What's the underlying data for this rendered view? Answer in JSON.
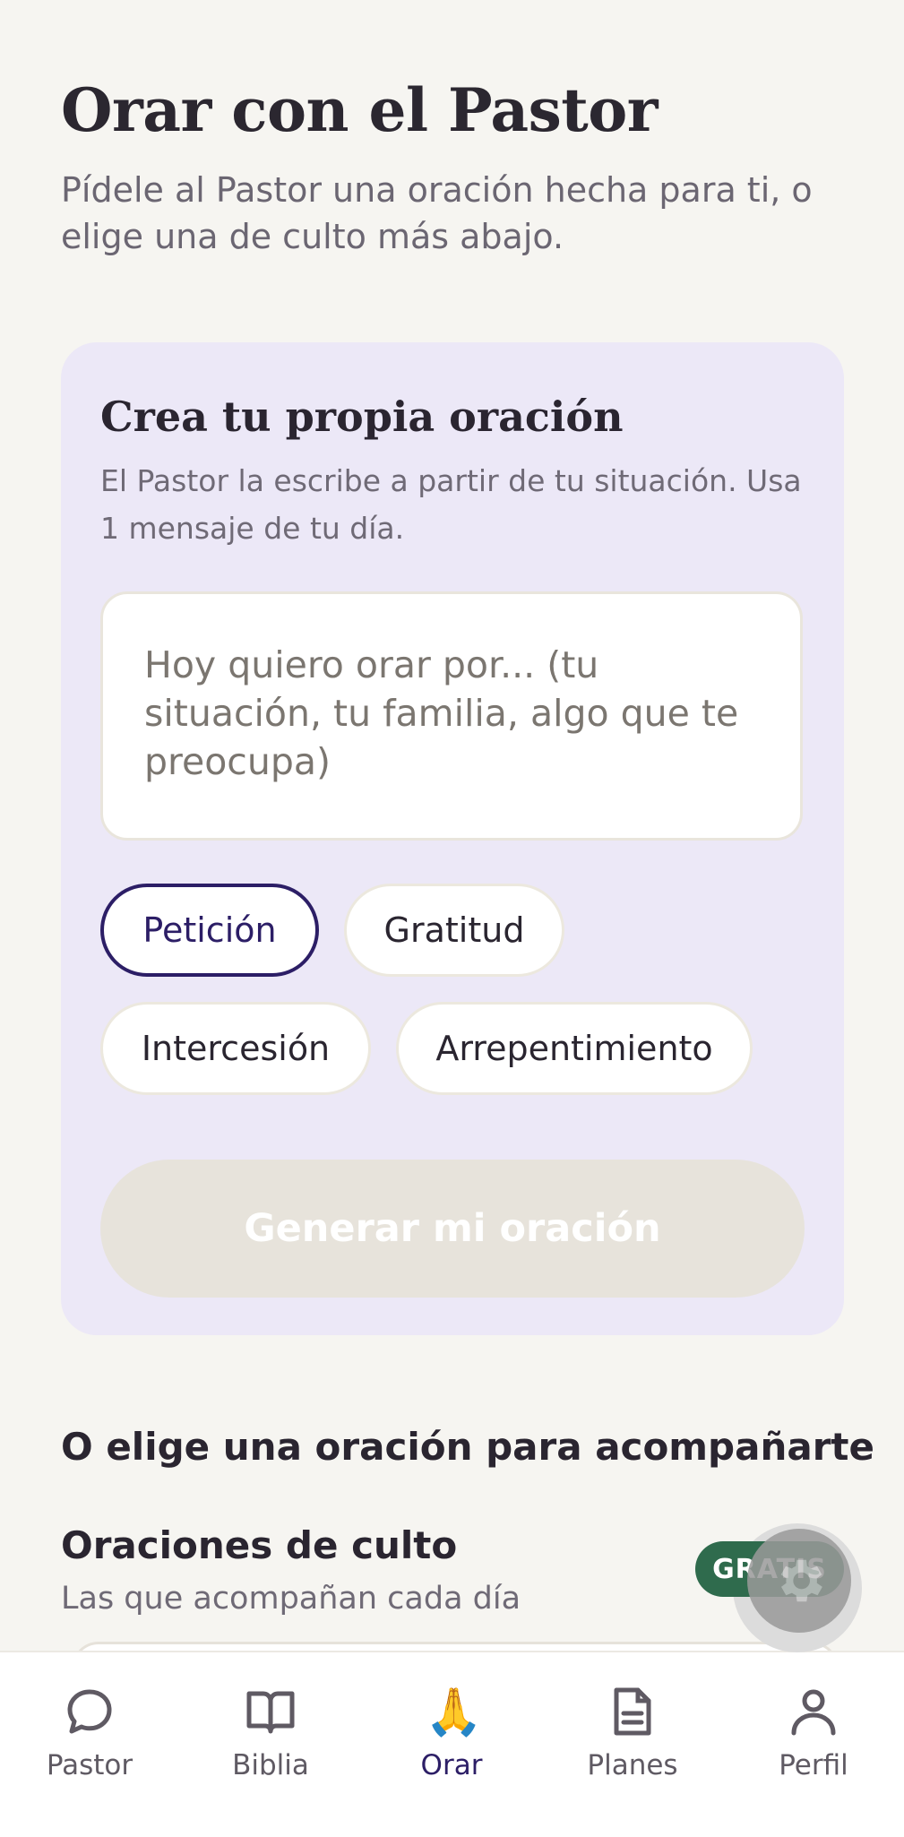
{
  "header": {
    "title": "Orar con el Pastor",
    "subtitle": "Pídele al Pastor una oración hecha para ti, o elige una de culto más abajo."
  },
  "create_card": {
    "title": "Crea tu propia oración",
    "description": "El Pastor la escribe a partir de tu situación. Usa 1 mensaje de tu día.",
    "input_value": "",
    "input_placeholder": "Hoy quiero orar por... (tu situación, tu familia, algo que te preocupa)",
    "chips": [
      {
        "label": "Petición",
        "selected": true
      },
      {
        "label": "Gratitud",
        "selected": false
      },
      {
        "label": "Intercesión",
        "selected": false
      },
      {
        "label": "Arrepentimiento",
        "selected": false
      }
    ],
    "generate_label": "Generar mi oración",
    "generate_enabled": false
  },
  "choose_section": {
    "heading": "O elige una oración para acompañarte",
    "subsection_title": "Oraciones de culto",
    "subsection_desc": "Las que acompañan cada día"
  },
  "floating": {
    "badge_label": "GRATIS",
    "fab_icon": "gear-icon"
  },
  "bottom_nav": {
    "items": [
      {
        "label": "Pastor",
        "icon": "chat-bubble-icon",
        "active": false
      },
      {
        "label": "Biblia",
        "icon": "open-book-icon",
        "active": false
      },
      {
        "label": "Orar",
        "icon": "praying-hands-icon",
        "active": true
      },
      {
        "label": "Planes",
        "icon": "document-icon",
        "active": false
      },
      {
        "label": "Perfil",
        "icon": "person-icon",
        "active": false
      }
    ]
  },
  "colors": {
    "background": "#f6f5f1",
    "card_background": "#ece8f7",
    "accent": "#2c1e66",
    "badge_green": "#2f6b4d",
    "disabled_button": "#e7e3db"
  }
}
